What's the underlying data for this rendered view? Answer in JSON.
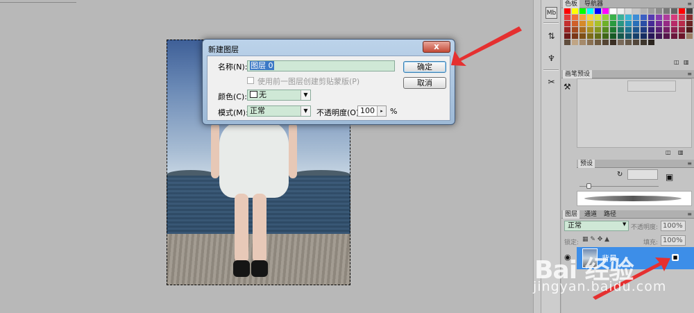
{
  "dialog": {
    "title": "新建图层",
    "close_label": "x",
    "name_label": "名称(N):",
    "name_value": "图层 0",
    "clip_checkbox_label": "使用前一图层创建剪贴蒙版(P)",
    "color_label": "颜色(C):",
    "color_value": "无",
    "mode_label": "模式(M):",
    "mode_value": "正常",
    "opacity_label": "不透明度(O):",
    "opacity_value": "100",
    "opacity_unit": "%",
    "ok_label": "确定",
    "cancel_label": "取消"
  },
  "swatches_panel": {
    "tabs": [
      "色板",
      "导航器"
    ],
    "colors": [
      "#ff0000",
      "#ffff00",
      "#00ff00",
      "#00ffff",
      "#0000ff",
      "#ff00ff",
      "#ffffff",
      "#f0f0f0",
      "#dcdcdc",
      "#c8c8c8",
      "#b4b4b4",
      "#a0a0a0",
      "#8c8c8c",
      "#787878",
      "#646464",
      "#ff0000",
      "#404040",
      "#000000",
      "#e23b3b",
      "#f06f3b",
      "#f5a33b",
      "#f8d43b",
      "#d7e33b",
      "#96cf3b",
      "#3bb14a",
      "#3bb09a",
      "#3bb4d6",
      "#3b8cd6",
      "#3b5fc2",
      "#553bb0",
      "#863bb0",
      "#b03b9c",
      "#d63b7c",
      "#d63b5a",
      "#8a2f2f",
      "#8a4f2f",
      "#c43030",
      "#d0602a",
      "#d68a2a",
      "#d4b72a",
      "#a9c12a",
      "#6eb02a",
      "#2a9a3f",
      "#2a9683",
      "#2a93b8",
      "#2a6fb8",
      "#2a4ea6",
      "#462a96",
      "#722a96",
      "#962a84",
      "#b82a68",
      "#b82a4a",
      "#6b2424",
      "#6b3b24",
      "#9a2525",
      "#a34a20",
      "#a86b20",
      "#a68f20",
      "#84961f",
      "#548a20",
      "#1f7830",
      "#1f7566",
      "#1f738f",
      "#1f568f",
      "#1f3c82",
      "#361f75",
      "#591f75",
      "#751f66",
      "#8f1f51",
      "#8f1f3a",
      "#511b1b",
      "#51301b",
      "#6e1a1a",
      "#7a3618",
      "#7e5018",
      "#7c6b18",
      "#636f17",
      "#3f6618",
      "#175925",
      "#17584c",
      "#17566b",
      "#17406b",
      "#172d61",
      "#281757",
      "#421757",
      "#57174c",
      "#6b173c",
      "#6b172b",
      "#9c7f66",
      "#7d6650",
      "#5f4d3d",
      "#c0a585",
      "#a58a6b",
      "#8a7052",
      "#6f5a40",
      "#544433",
      "#3b2f24",
      "#7a6a5a",
      "#665848",
      "#52463a",
      "#3e362d",
      "#2b251f"
    ],
    "icons": [
      "new-swatch-icon",
      "trash-icon"
    ]
  },
  "brush_presets_panel": {
    "tab": "画笔预设",
    "icons": [
      "new-preset-icon",
      "trash-icon"
    ]
  },
  "tool_presets_panel": {
    "tab": "预设",
    "icons": [
      "refresh-icon",
      "stamp-icon"
    ]
  },
  "layers_panel": {
    "tabs": [
      "图层",
      "通道",
      "路径"
    ],
    "blend_mode": "正常",
    "opacity_label": "不透明度:",
    "opacity_value": "100%",
    "lock_label": "锁定:",
    "fill_label": "填充:",
    "fill_value": "100%",
    "layer_name": "背景"
  },
  "dock": {
    "icons": [
      "mini-bridge-icon",
      "clone-source-icon",
      "puppet-icon",
      "tools-icon"
    ],
    "labels": [
      "Mb",
      "",
      "",
      ""
    ]
  },
  "watermark": {
    "logo": "Bai 经验",
    "url": "jingyan.baidu.com"
  },
  "colors": {
    "selection_blue": "#3d8ee8",
    "arrow_red": "#e53030"
  }
}
